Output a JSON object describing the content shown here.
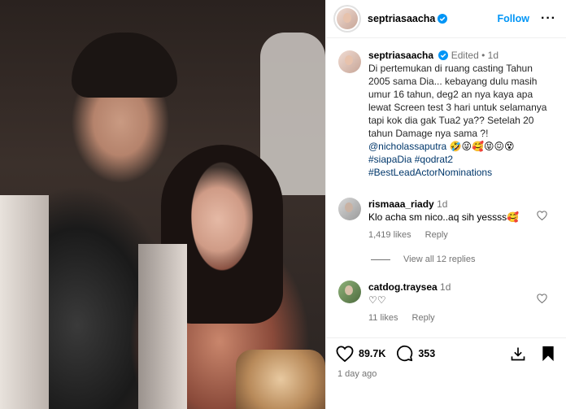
{
  "post": {
    "username": "septriasaacha",
    "follow_label": "Follow",
    "more_label": "···"
  },
  "caption": {
    "username": "septriasaacha",
    "edited": "Edited",
    "dot": "•",
    "time": "1d",
    "text": "Di pertemukan di ruang casting Tahun 2005 sama Dia... kebayang dulu masih umur 16 tahun,  deg2 an nya kaya apa lewat Screen test 3 hari untuk selamanya tapi kok dia gak Tua2 ya?? Setelah 20 tahun Damage nya sama ?!",
    "mention": "@nicholassaputra",
    "emojis": "🤣😜🥰😝😖😵",
    "hashtags": [
      "#siapaDia",
      "#qodrat2",
      "#BestLeadActorNominations"
    ]
  },
  "comments": [
    {
      "username": "rismaaa_riady",
      "time": "1d",
      "text": "Klo acha sm nico..aq sih yessss🥰",
      "likes": "1,419 likes",
      "reply": "Reply"
    },
    {
      "username": "catdog.traysea",
      "time": "1d",
      "text": "♡♡",
      "likes": "11 likes",
      "reply": "Reply"
    }
  ],
  "view_all": "View all 12 replies",
  "actions": {
    "likes_count": "89.7K",
    "comments_count": "353"
  },
  "timestamp": "1 day ago",
  "colors": {
    "accent": "#0095f6",
    "link": "#00376b",
    "muted": "#737373",
    "verified": "#0095f6"
  }
}
